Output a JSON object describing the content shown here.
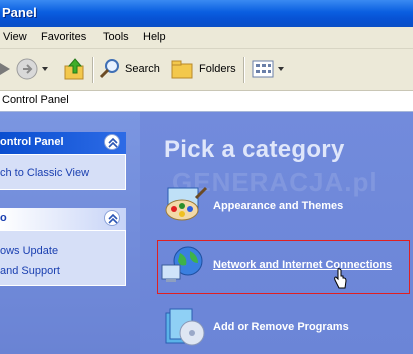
{
  "window": {
    "title": "Panel"
  },
  "menu": {
    "items": [
      "View",
      "Favorites",
      "Tools",
      "Help"
    ]
  },
  "toolbar": {
    "search_label": "Search",
    "folders_label": "Folders"
  },
  "address": {
    "value": "Control Panel"
  },
  "left_pane": {
    "panel1": {
      "title": "ontrol Panel",
      "link": "ch to Classic View"
    },
    "panel2": {
      "title": "o",
      "links": [
        "ows Update",
        "and Support"
      ]
    }
  },
  "main": {
    "heading": "Pick a category",
    "watermark": "GENERACJA.pl",
    "categories": [
      {
        "label": "Appearance and Themes",
        "icon": "appearance-icon"
      },
      {
        "label": "Network and Internet Connections",
        "icon": "network-icon"
      },
      {
        "label": "Add or Remove Programs",
        "icon": "programs-icon"
      }
    ]
  },
  "colors": {
    "accent": "#0a5ee0",
    "highlight": "#e02020",
    "pane": "#6c86d8"
  }
}
